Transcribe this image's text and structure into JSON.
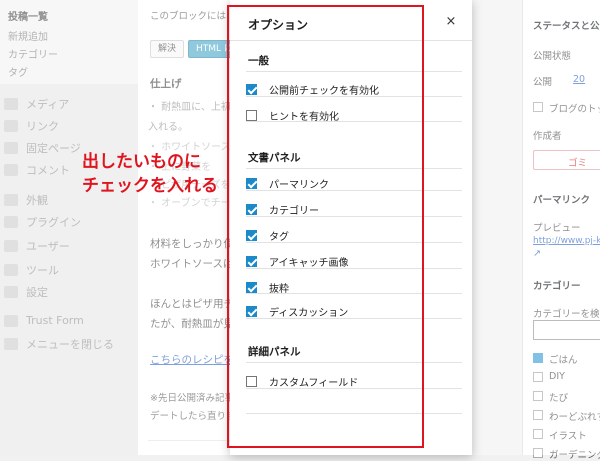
{
  "sidebar": {
    "submenu": [
      "投稿一覧",
      "新規追加",
      "カテゴリー",
      "タグ"
    ],
    "menu": [
      {
        "label": "メディア",
        "icon": "media-icon"
      },
      {
        "label": "リンク",
        "icon": "link-icon"
      },
      {
        "label": "固定ページ",
        "icon": "page-icon"
      },
      {
        "label": "コメント",
        "icon": "comment-icon"
      },
      {
        "label": "外観",
        "icon": "appearance-icon"
      },
      {
        "label": "プラグイン",
        "icon": "plugin-icon"
      },
      {
        "label": "ユーザー",
        "icon": "user-icon"
      },
      {
        "label": "ツール",
        "icon": "tool-icon"
      },
      {
        "label": "設定",
        "icon": "settings-icon"
      },
      {
        "label": "Trust Form",
        "icon": "form-icon"
      },
      {
        "label": "メニューを閉じる",
        "icon": "collapse-icon"
      }
    ]
  },
  "editor": {
    "block_hint": "このブロックには、想",
    "btn_edit": "解決",
    "btn_html": "HTML に変",
    "heading": "仕上げ",
    "bullets": [
      "・ 耐熱皿に、上初",
      "入れる。",
      "・ ホワイトソース",
      "・ 上に野菜を",
      "・ ピザ用チーズを",
      "・ オーブンでチー"
    ],
    "para1": [
      "材料をしっかり使",
      "ホワイトソースは"
    ],
    "para2": [
      "ほんとはピザ用チ",
      "たが、耐熱皿が見"
    ],
    "link": "こちらのレシピを",
    "note": [
      "※先日公開済み記事の",
      "デートしたら直りまし"
    ]
  },
  "modal": {
    "title": "オプション",
    "close": "×",
    "sections": [
      {
        "title": "一般",
        "options": [
          {
            "label": "公開前チェックを有効化",
            "checked": true
          },
          {
            "label": "ヒントを有効化",
            "checked": false
          }
        ]
      },
      {
        "title": "文書パネル",
        "options": [
          {
            "label": "パーマリンク",
            "checked": true
          },
          {
            "label": "カテゴリー",
            "checked": true
          },
          {
            "label": "タグ",
            "checked": true
          },
          {
            "label": "アイキャッチ画像",
            "checked": true
          },
          {
            "label": "抜粋",
            "checked": true
          },
          {
            "label": "ディスカッション",
            "checked": true
          }
        ]
      },
      {
        "title": "詳細パネル",
        "options": [
          {
            "label": "カスタムフィールド",
            "checked": false
          }
        ]
      }
    ]
  },
  "annotation": {
    "line1": "出したいものに",
    "line2": "チェックを入れる",
    "color": "#e0141e"
  },
  "right_panel": {
    "status_title": "ステータスと公開",
    "visibility": "公開状態",
    "publish": "公開",
    "publish_val": "20",
    "sticky": "ブログのトッ",
    "author": "作成者",
    "trash": "ゴミ",
    "permalink_title": "パーマリンク",
    "preview": "プレビュー",
    "preview_url": "http://www.pj-kun",
    "categories_title": "カテゴリー",
    "cat_search": "カテゴリーを検索",
    "cats": [
      {
        "label": "ごはん",
        "checked": true
      },
      {
        "label": "DIY",
        "checked": false
      },
      {
        "label": "たび",
        "checked": false
      },
      {
        "label": "わーどぷれす",
        "checked": false
      },
      {
        "label": "イラスト",
        "checked": false
      },
      {
        "label": "ガーデニング",
        "checked": false
      }
    ]
  }
}
